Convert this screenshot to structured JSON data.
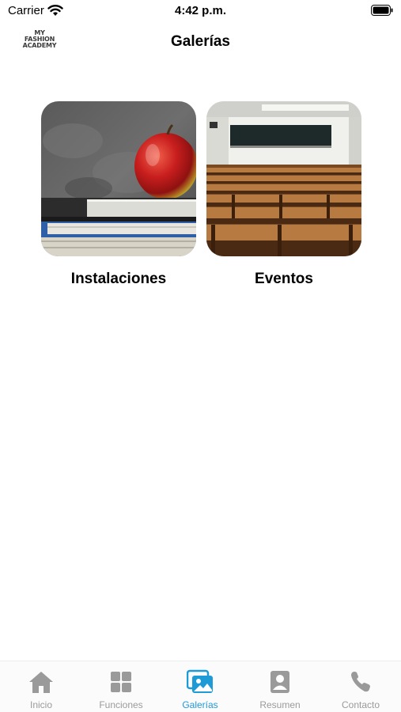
{
  "status_bar": {
    "carrier": "Carrier",
    "time": "4:42 p.m."
  },
  "nav": {
    "logo_lines": [
      "MY",
      "FASHION",
      "ACADEMY"
    ],
    "title": "Galerías"
  },
  "galleries": [
    {
      "label": "Instalaciones",
      "icon": "apple-books-photo"
    },
    {
      "label": "Eventos",
      "icon": "auditorium-seats-photo"
    }
  ],
  "tab_bar": {
    "active_color": "#1e9bd7",
    "inactive_color": "#9a9a9a",
    "tabs": [
      {
        "label": "Inicio",
        "icon": "home-icon",
        "active": false
      },
      {
        "label": "Funciones",
        "icon": "grid-icon",
        "active": false
      },
      {
        "label": "Galerías",
        "icon": "gallery-icon",
        "active": true
      },
      {
        "label": "Resumen",
        "icon": "contact-card-icon",
        "active": false
      },
      {
        "label": "Contacto",
        "icon": "phone-icon",
        "active": false
      }
    ]
  }
}
